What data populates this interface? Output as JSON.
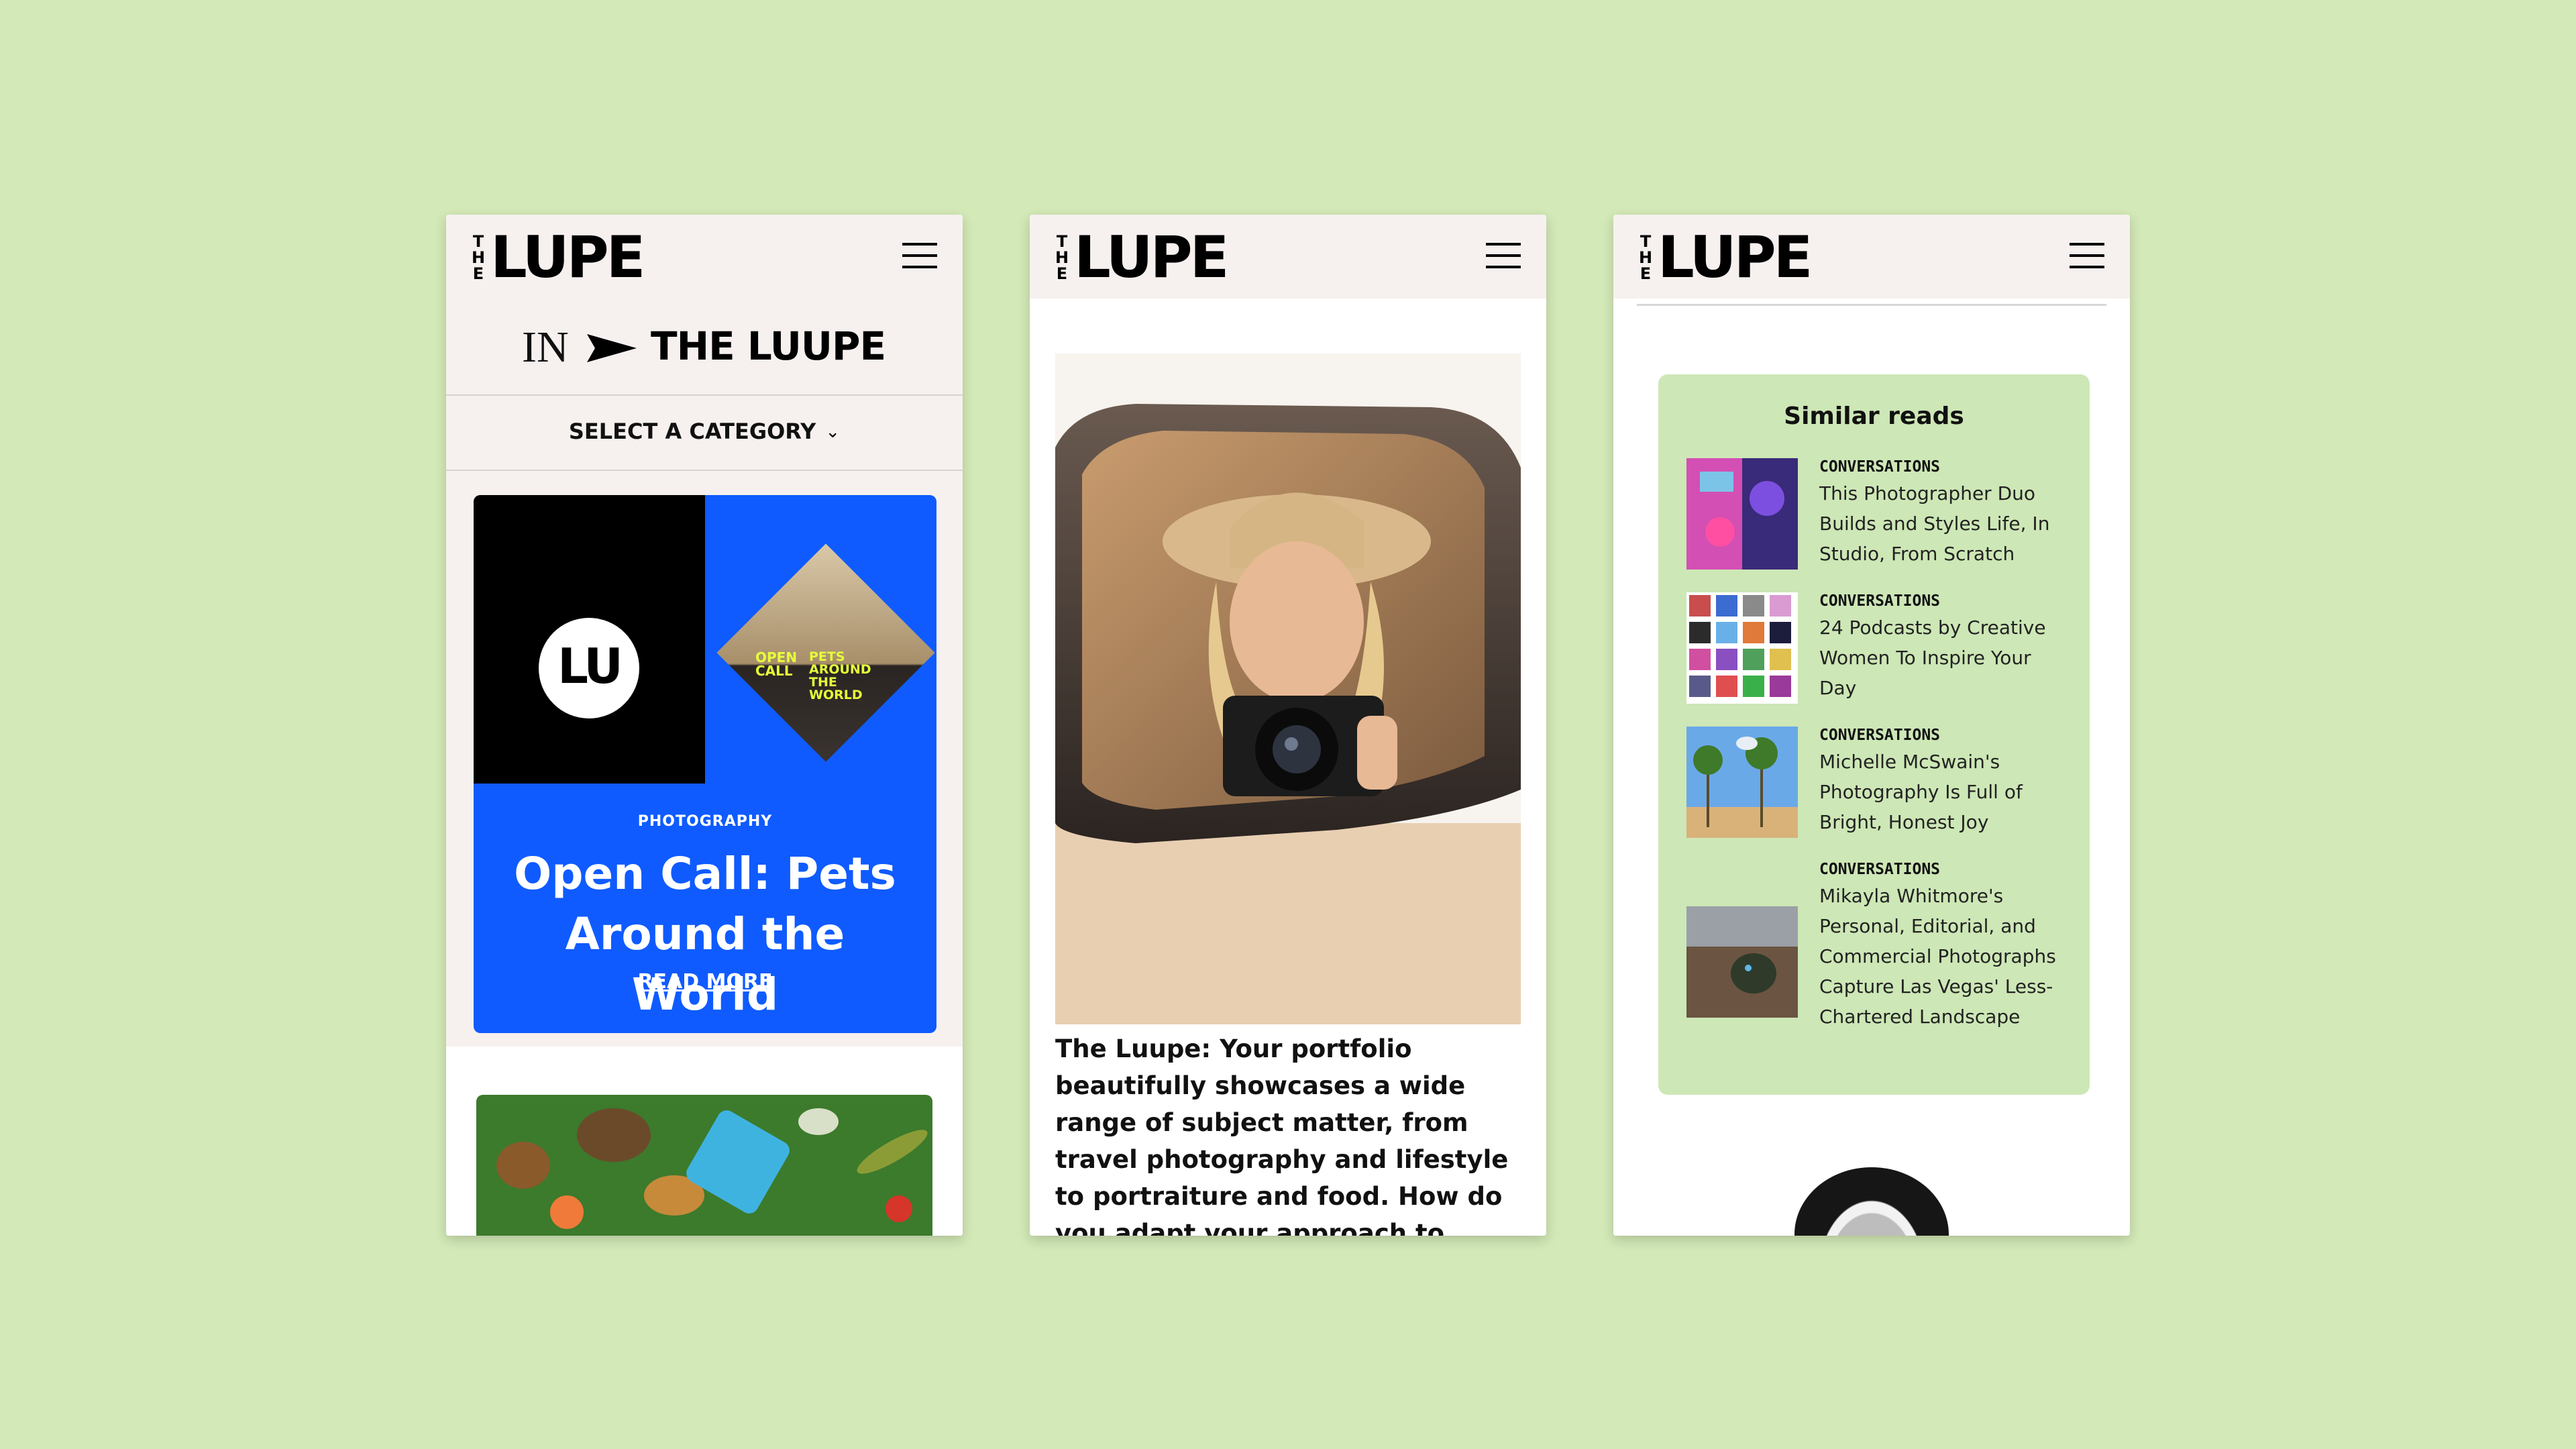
{
  "background_color": "#d3e9b7",
  "brand": {
    "logo_the": "THE",
    "logo_word": "LUPE",
    "accent_blue": "#0f5bff"
  },
  "phone1": {
    "header": {
      "logo_alt": "THE LUUPE",
      "menu_icon": "hamburger-menu-icon"
    },
    "in_label": "IN",
    "in_brand": "THE LUUPE",
    "category_select": "SELECT A CATEGORY",
    "feature": {
      "tag": "PHOTOGRAPHY",
      "title": "Open Call: Pets Around the World",
      "link": "READ MORE",
      "circle_logo": "LU",
      "diamond_left": "OPEN CALL",
      "diamond_right": "PETS AROUND THE WORLD"
    }
  },
  "phone2": {
    "question": "The Luupe: Your portfolio beautifully showcases a wide range of subject matter, from travel photography and lifestyle to portraiture and food. How do you adapt your approach to different genres of photography?"
  },
  "phone3": {
    "section_title": "Similar reads",
    "reads": [
      {
        "tag": "CONVERSATIONS",
        "title": "This Photographer Duo Builds and Styles Life, In Studio, From Scratch"
      },
      {
        "tag": "CONVERSATIONS",
        "title": "24 Podcasts by Creative Women To Inspire Your Day"
      },
      {
        "tag": "CONVERSATIONS",
        "title": "Michelle McSwain's Photography Is Full of Bright, Honest Joy"
      },
      {
        "tag": "CONVERSATIONS",
        "title": "Mikayla Whitmore's Personal, Editorial, and Commercial Photographs Capture Las Vegas' Less-Chartered Landscape"
      }
    ]
  }
}
